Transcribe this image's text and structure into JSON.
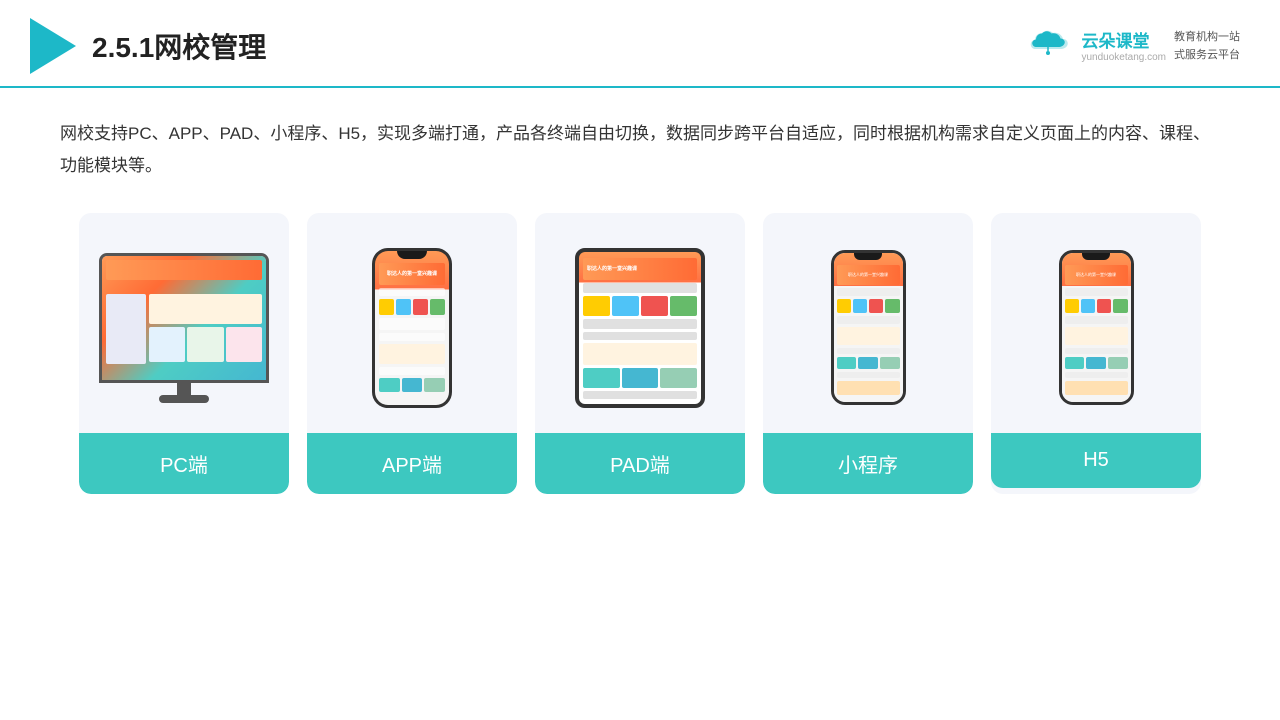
{
  "header": {
    "title": "2.5.1网校管理",
    "logo": {
      "name": "云朵课堂",
      "url": "yunduoketang.com",
      "slogan1": "教育机构一站",
      "slogan2": "式服务云平台"
    }
  },
  "body": {
    "description": "网校支持PC、APP、PAD、小程序、H5，实现多端打通，产品各终端自由切换，数据同步跨平台自适应，同时根据机构需求自定义页面上的内容、课程、功能模块等。"
  },
  "cards": [
    {
      "id": "pc",
      "label": "PC端"
    },
    {
      "id": "app",
      "label": "APP端"
    },
    {
      "id": "pad",
      "label": "PAD端"
    },
    {
      "id": "miniprogram",
      "label": "小程序"
    },
    {
      "id": "h5",
      "label": "H5"
    }
  ]
}
